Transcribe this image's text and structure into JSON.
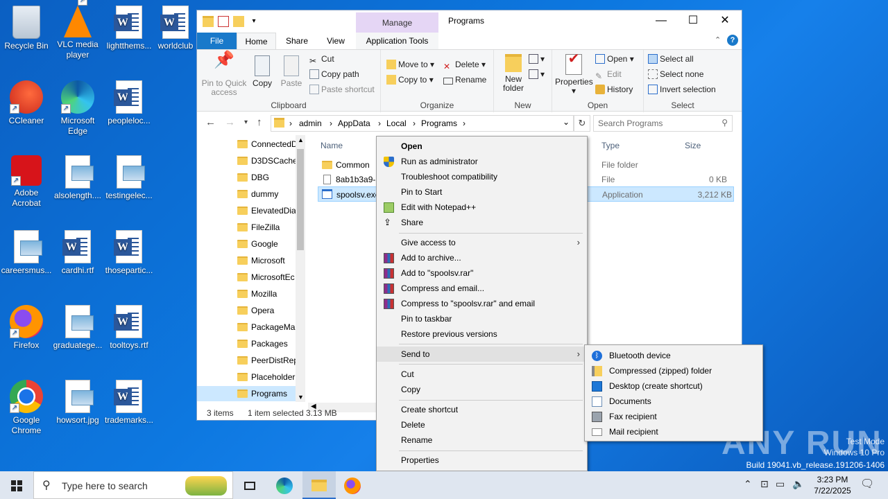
{
  "desktop": {
    "icons": [
      {
        "label": "Recycle Bin",
        "icon": "recycle-bin-icon"
      },
      {
        "label": "VLC media player",
        "icon": "vlc-icon"
      },
      {
        "label": "lightthems...",
        "icon": "word-doc-icon"
      },
      {
        "label": "worldclub",
        "icon": "word-doc-icon"
      },
      {
        "label": "CCleaner",
        "icon": "ccleaner-icon"
      },
      {
        "label": "Microsoft Edge",
        "icon": "edge-icon"
      },
      {
        "label": "peopleloc...",
        "icon": "word-doc-icon"
      },
      {
        "label": "Adobe Acrobat",
        "icon": "acrobat-icon"
      },
      {
        "label": "alsolength....",
        "icon": "image-file-icon"
      },
      {
        "label": "testingelec...",
        "icon": "image-file-icon"
      },
      {
        "label": "careersmus...",
        "icon": "image-file-icon"
      },
      {
        "label": "cardhi.rtf",
        "icon": "word-doc-icon"
      },
      {
        "label": "thosepartic...",
        "icon": "word-doc-icon"
      },
      {
        "label": "Firefox",
        "icon": "firefox-icon"
      },
      {
        "label": "graduatege...",
        "icon": "image-file-icon"
      },
      {
        "label": "tooltoys.rtf",
        "icon": "word-doc-icon"
      },
      {
        "label": "Google Chrome",
        "icon": "chrome-icon"
      },
      {
        "label": "howsort.jpg",
        "icon": "image-file-icon"
      },
      {
        "label": "trademarks...",
        "icon": "word-doc-icon"
      }
    ]
  },
  "explorer": {
    "title": "Programs",
    "manage_tab": "Manage",
    "tabs": {
      "file": "File",
      "home": "Home",
      "share": "Share",
      "view": "View",
      "app_tools": "Application Tools"
    },
    "ribbon": {
      "clipboard": {
        "label": "Clipboard",
        "pin": "Pin to Quick access",
        "copy": "Copy",
        "paste": "Paste",
        "cut": "Cut",
        "copy_path": "Copy path",
        "paste_shortcut": "Paste shortcut"
      },
      "organize": {
        "label": "Organize",
        "move_to": "Move to",
        "copy_to": "Copy to",
        "delete": "Delete",
        "rename": "Rename"
      },
      "new": {
        "label": "New",
        "new_folder": "New folder"
      },
      "open": {
        "label": "Open",
        "properties": "Properties",
        "open": "Open",
        "edit": "Edit",
        "history": "History"
      },
      "select": {
        "label": "Select",
        "select_all": "Select all",
        "select_none": "Select none",
        "invert": "Invert selection"
      }
    },
    "address": {
      "path": [
        "admin",
        "AppData",
        "Local",
        "Programs"
      ],
      "search_placeholder": "Search Programs"
    },
    "nav_items": [
      "ConnectedD",
      "D3DSCache",
      "DBG",
      "dummy",
      "ElevatedDia",
      "FileZilla",
      "Google",
      "Microsoft",
      "MicrosoftEc",
      "Mozilla",
      "Opera",
      "PackageMa",
      "Packages",
      "PeerDistRep",
      "Placeholder",
      "Programs"
    ],
    "columns": {
      "name": "Name",
      "type": "Type",
      "size": "Size"
    },
    "files": [
      {
        "name": "Common",
        "type": "File folder",
        "size": ""
      },
      {
        "name": "8ab1b3a9-5",
        "type": "File",
        "size": "0 KB"
      },
      {
        "name": "spoolsv.exe",
        "type": "Application",
        "size": "3,212 KB"
      }
    ],
    "status": {
      "count": "3 items",
      "selected": "1 item selected",
      "size": "3.13 MB"
    }
  },
  "context_menu": {
    "open": "Open",
    "run_admin": "Run as administrator",
    "troubleshoot": "Troubleshoot compatibility",
    "pin_start": "Pin to Start",
    "edit_npp": "Edit with Notepad++",
    "share": "Share",
    "give_access": "Give access to",
    "add_archive": "Add to archive...",
    "add_rar": "Add to \"spoolsv.rar\"",
    "compress_email": "Compress and email...",
    "compress_rar_email": "Compress to \"spoolsv.rar\" and email",
    "pin_taskbar": "Pin to taskbar",
    "restore": "Restore previous versions",
    "send_to": "Send to",
    "cut": "Cut",
    "copy": "Copy",
    "create_shortcut": "Create shortcut",
    "delete": "Delete",
    "rename": "Rename",
    "properties": "Properties"
  },
  "send_to_menu": {
    "bluetooth": "Bluetooth device",
    "zip": "Compressed (zipped) folder",
    "desktop": "Desktop (create shortcut)",
    "documents": "Documents",
    "fax": "Fax recipient",
    "mail": "Mail recipient"
  },
  "taskbar": {
    "search_placeholder": "Type here to search",
    "time": "3:23 PM",
    "date": "7/22/2025"
  },
  "watermark": {
    "test_mode": "Test Mode",
    "edition": "Windows 10 Pro",
    "build": "Build 19041.vb_release.191206-1406",
    "brand": "ANY RUN"
  }
}
